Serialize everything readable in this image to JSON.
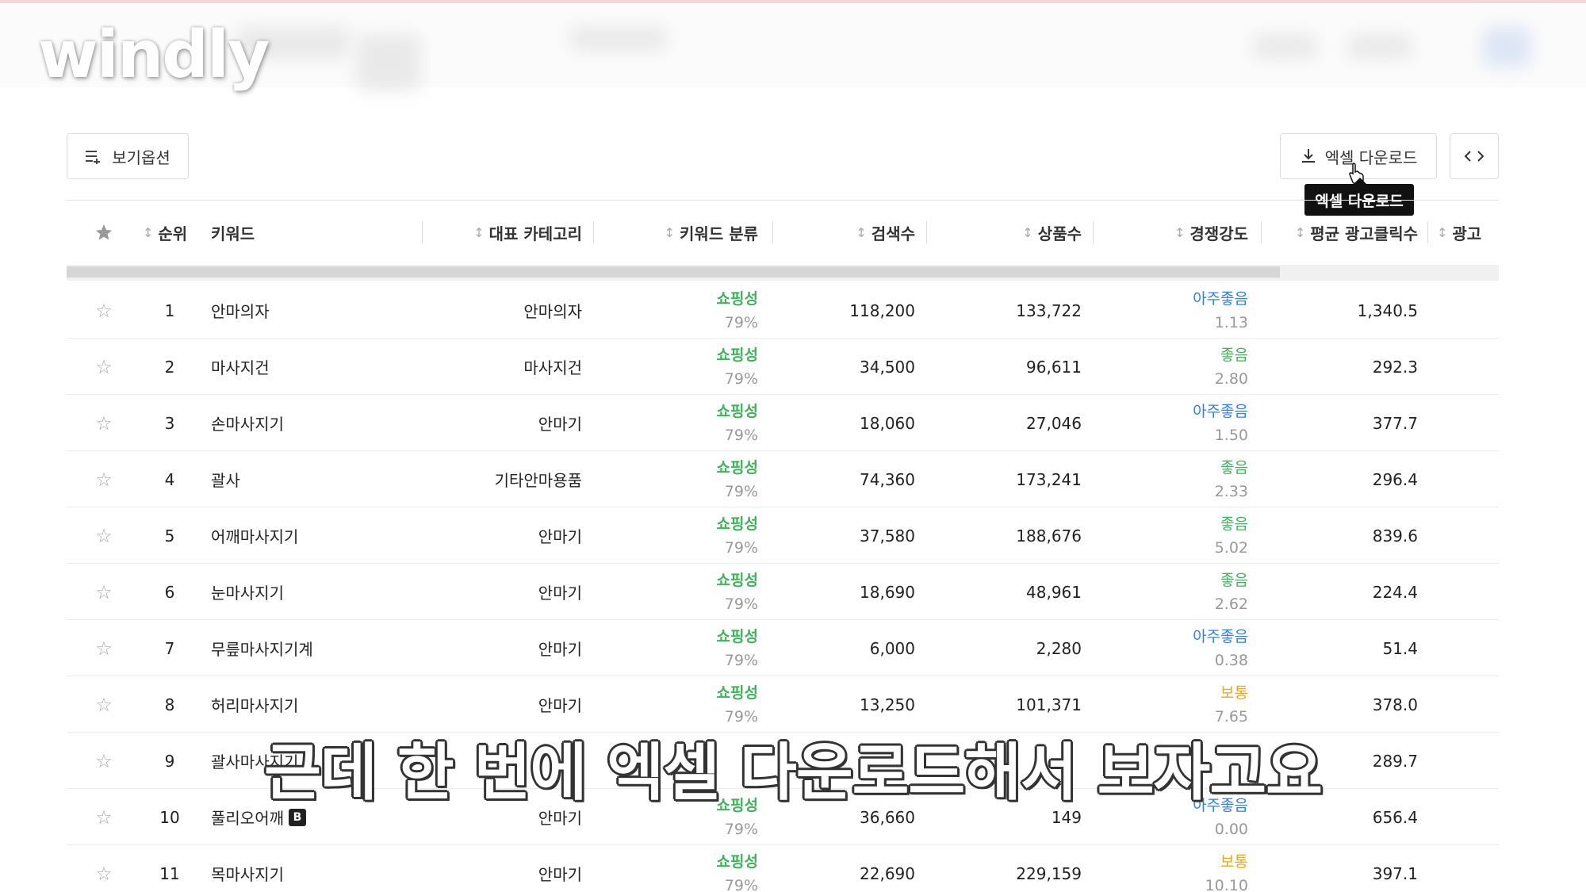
{
  "brand": {
    "logo_text": "windly"
  },
  "toolbar": {
    "view_options_label": "보기옵션",
    "excel_download_label": "엑셀 다운로드",
    "tooltip_text": "엑셀 다운로드"
  },
  "colors": {
    "shopping": "#3fb35a",
    "very_good": "#2f80ed",
    "good": "#3fb35a",
    "normal": "#f2a51a"
  },
  "table": {
    "headers": {
      "rank": "순위",
      "keyword": "키워드",
      "category": "대표 카테고리",
      "keyword_type": "키워드 분류",
      "search_count": "검색수",
      "product_count": "상품수",
      "competition": "경쟁강도",
      "avg_ad_clicks": "평균 광고클릭수",
      "ad": "광고"
    },
    "rows": [
      {
        "rank": "1",
        "keyword": "안마의자",
        "badge": "",
        "category": "안마의자",
        "type": "쇼핑성",
        "type_pct": "79%",
        "search": "118,200",
        "products": "133,722",
        "comp_label": "아주좋음",
        "comp_level": "very_good",
        "comp_value": "1.13",
        "clicks": "1,340.5"
      },
      {
        "rank": "2",
        "keyword": "마사지건",
        "badge": "",
        "category": "마사지건",
        "type": "쇼핑성",
        "type_pct": "79%",
        "search": "34,500",
        "products": "96,611",
        "comp_label": "좋음",
        "comp_level": "good",
        "comp_value": "2.80",
        "clicks": "292.3"
      },
      {
        "rank": "3",
        "keyword": "손마사지기",
        "badge": "",
        "category": "안마기",
        "type": "쇼핑성",
        "type_pct": "79%",
        "search": "18,060",
        "products": "27,046",
        "comp_label": "아주좋음",
        "comp_level": "very_good",
        "comp_value": "1.50",
        "clicks": "377.7"
      },
      {
        "rank": "4",
        "keyword": "괄사",
        "badge": "",
        "category": "기타안마용품",
        "type": "쇼핑성",
        "type_pct": "79%",
        "search": "74,360",
        "products": "173,241",
        "comp_label": "좋음",
        "comp_level": "good",
        "comp_value": "2.33",
        "clicks": "296.4"
      },
      {
        "rank": "5",
        "keyword": "어깨마사지기",
        "badge": "",
        "category": "안마기",
        "type": "쇼핑성",
        "type_pct": "79%",
        "search": "37,580",
        "products": "188,676",
        "comp_label": "좋음",
        "comp_level": "good",
        "comp_value": "5.02",
        "clicks": "839.6"
      },
      {
        "rank": "6",
        "keyword": "눈마사지기",
        "badge": "",
        "category": "안마기",
        "type": "쇼핑성",
        "type_pct": "79%",
        "search": "18,690",
        "products": "48,961",
        "comp_label": "좋음",
        "comp_level": "good",
        "comp_value": "2.62",
        "clicks": "224.4"
      },
      {
        "rank": "7",
        "keyword": "무릎마사지기계",
        "badge": "",
        "category": "안마기",
        "type": "쇼핑성",
        "type_pct": "79%",
        "search": "6,000",
        "products": "2,280",
        "comp_label": "아주좋음",
        "comp_level": "very_good",
        "comp_value": "0.38",
        "clicks": "51.4"
      },
      {
        "rank": "8",
        "keyword": "허리마사지기",
        "badge": "",
        "category": "안마기",
        "type": "쇼핑성",
        "type_pct": "79%",
        "search": "13,250",
        "products": "101,371",
        "comp_label": "보통",
        "comp_level": "normal",
        "comp_value": "7.65",
        "clicks": "378.0"
      },
      {
        "rank": "9",
        "keyword": "괄사마사지기",
        "badge": "",
        "category": "",
        "type": "",
        "type_pct": "",
        "search": "",
        "products": "",
        "comp_label": "",
        "comp_level": "good",
        "comp_value": "",
        "clicks": "289.7"
      },
      {
        "rank": "10",
        "keyword": "풀리오어깨",
        "badge": "B",
        "category": "안마기",
        "type": "쇼핑성",
        "type_pct": "79%",
        "search": "36,660",
        "products": "149",
        "comp_label": "아주좋음",
        "comp_level": "very_good",
        "comp_value": "0.00",
        "clicks": "656.4"
      },
      {
        "rank": "11",
        "keyword": "목마사지기",
        "badge": "",
        "category": "안마기",
        "type": "쇼핑성",
        "type_pct": "79%",
        "search": "22,690",
        "products": "229,159",
        "comp_label": "보통",
        "comp_level": "normal",
        "comp_value": "10.10",
        "clicks": "397.1"
      }
    ]
  },
  "subtitle": "근데 한 번에 엑셀 다운로드해서 보자고요"
}
